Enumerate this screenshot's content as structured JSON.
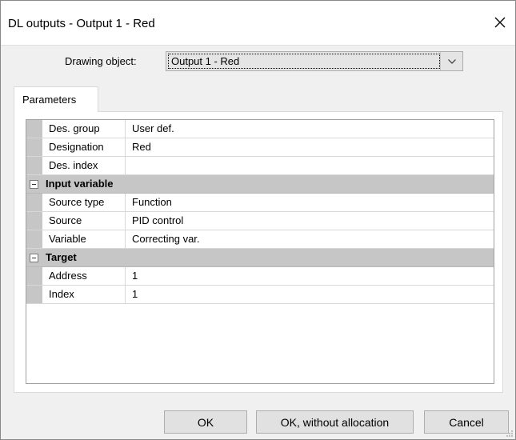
{
  "window": {
    "title": "DL outputs - Output 1 - Red"
  },
  "drawing_object": {
    "label": "Drawing object:",
    "value": "Output 1 - Red"
  },
  "tabs": [
    {
      "label": "Parameters",
      "active": true
    }
  ],
  "grid": {
    "rows_top": [
      {
        "name": "Des. group",
        "value": "User def."
      },
      {
        "name": "Designation",
        "value": "Red"
      },
      {
        "name": "Des. index",
        "value": ""
      }
    ],
    "input_variable": {
      "label": "Input variable",
      "rows": [
        {
          "name": "Source type",
          "value": "Function"
        },
        {
          "name": "Source",
          "value": "PID control"
        },
        {
          "name": "Variable",
          "value": "Correcting var."
        }
      ]
    },
    "target": {
      "label": "Target",
      "rows": [
        {
          "name": "Address",
          "value": "1"
        },
        {
          "name": "Index",
          "value": "1"
        }
      ]
    }
  },
  "buttons": {
    "ok": "OK",
    "ok_without_allocation": "OK, without allocation",
    "cancel": "Cancel"
  },
  "icons": {
    "close": "close-icon",
    "dropdown": "chevron-down-icon",
    "collapse": "collapse-minus-icon",
    "resize": "resize-grip-icon"
  },
  "colors": {
    "title_bg": "#ffffff",
    "dialog_bg": "#f0f0f0",
    "gutter": "#c6c6c6",
    "button_bg": "#e1e1e1"
  }
}
